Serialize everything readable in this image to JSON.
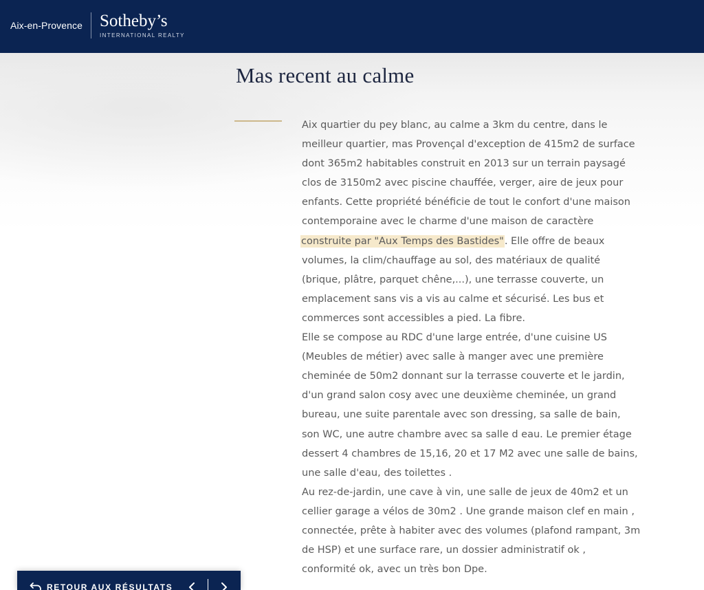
{
  "header": {
    "city": "Aix-en-Provence",
    "logo_main": "Sotheby’s",
    "logo_sub": "INTERNATIONAL REALTY"
  },
  "listing": {
    "title": "Mas recent au calme",
    "description_lines": [
      "Aix quartier du pey blanc, au calme a 3km du centre, dans le",
      "meilleur quartier, mas Provençal d'exception de 415m2 de surface",
      "dont 365m2 habitables construit en 2013 sur un terrain paysagé",
      "clos de 3150m2 avec piscine chauffée, verger, aire de jeux pour",
      "enfants. Cette propriété bénéficie de tout le confort d'une maison",
      "contemporaine avec le charme d'une maison de caractère",
      "",
      "volumes, la clim/chauffage au sol, des matériaux de qualité",
      "(brique, plâtre, parquet chêne,...), une terrasse couverte, un",
      "emplacement sans vis a vis au calme et sécurisé. Les bus et",
      "commerces sont accessibles a pied. La fibre.",
      "Elle se compose au RDC d'une large entrée, d'une cuisine US",
      "(Meubles de métier) avec salle à manger avec une première",
      "cheminée de 50m2 donnant sur la terrasse couverte et le jardin,",
      "d'un grand salon cosy avec une deuxième cheminée, un grand",
      "bureau, une suite parentale avec son dressing, sa salle de bain,",
      "son WC, une autre chambre avec sa salle d eau. Le premier étage",
      "dessert 4 chambres de 15,16, 20 et 17 M2 avec une salle de bains,",
      "une salle d'eau, des toilettes .",
      "Au rez-de-jardin, une cave à vin, une salle de jeux de 40m2 et un",
      "cellier garage a vélos de 30m2 . Une grande maison clef en main ,",
      "connectée, prête à habiter avec des volumes (plafond rampant, 3m",
      "de HSP) et une surface rare, un dossier administratif ok ,",
      "conformité ok, avec un très bon Dpe."
    ],
    "highlight_text": "construite par \"Aux Temps des Bastides\"",
    "highlight_after": ". Elle offre de beaux",
    "highlight_color": "#f6e9cb"
  },
  "nav": {
    "back_label": "RETOUR AUX RÉSULTATS",
    "back_icon": "return-arrow-icon",
    "prev_icon": "chevron-left-icon",
    "next_icon": "chevron-right-icon"
  },
  "colors": {
    "navy": "#0b2452",
    "gold": "#cdb88b",
    "title": "#1d2640",
    "text": "#5a5a5a"
  }
}
